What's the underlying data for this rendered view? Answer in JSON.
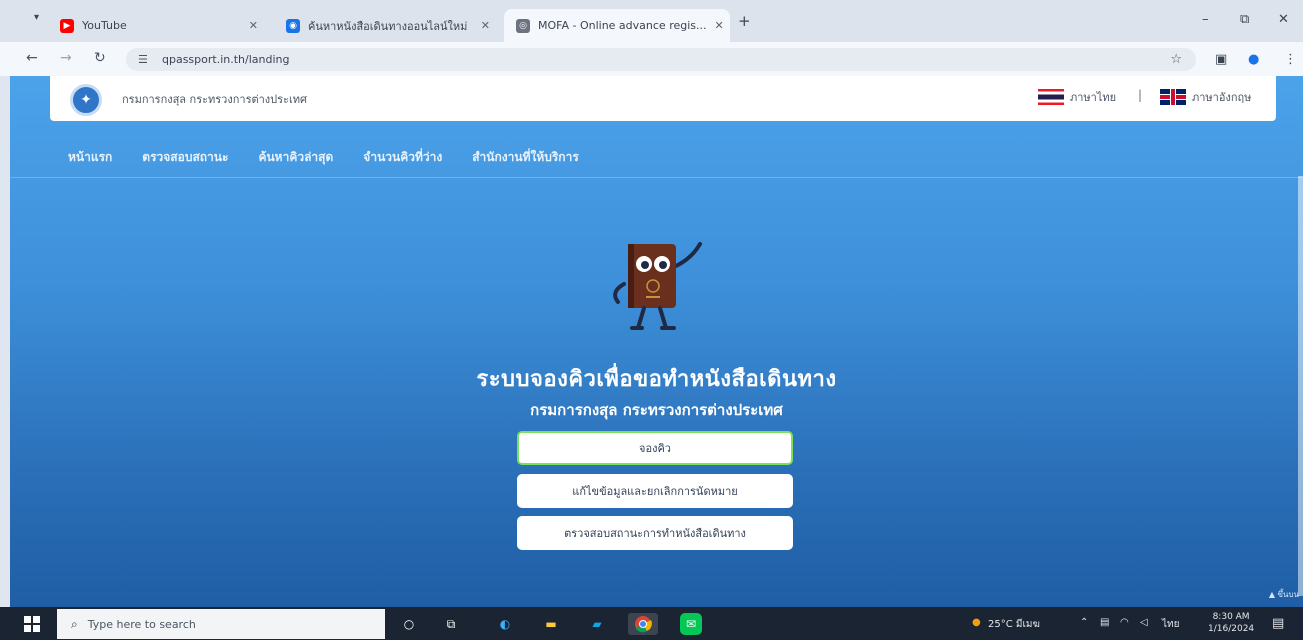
{
  "browser": {
    "tabs": [
      {
        "title": "YouTube",
        "active": false,
        "favicon_color": "#ff0000"
      },
      {
        "title": "ค้นหาหนังสือเดินทางออนไลน์ใหม่",
        "active": false,
        "favicon_color": "#1a73e8"
      },
      {
        "title": "MOFA - Online advance regis...",
        "active": true,
        "favicon_color": "#6b7280"
      }
    ],
    "new_tab_label": "+",
    "url": "qpassport.in.th/landing",
    "window_controls": [
      "–",
      "⧉",
      "✕"
    ]
  },
  "site": {
    "org_name": "กรมการกงสุล กระทรวงการต่างประเทศ",
    "lang_th": "ภาษาไทย",
    "lang_en": "ภาษาอังกฤษ",
    "lang_separator": "|",
    "nav": [
      "หน้าแรก",
      "ตรวจสอบสถานะ",
      "ค้นหาคิวล่าสุด",
      "จำนวนคิวที่ว่าง",
      "สำนักงานที่ให้บริการ"
    ],
    "hero_title": "ระบบจองคิวเพื่อขอทำหนังสือเดินทาง",
    "hero_subtitle": "กรมการกงสุล กระทรวงการต่างประเทศ",
    "buttons": {
      "book": "จองคิว",
      "edit": "แก้ไขข้อมูลและยกเลิกการนัดหมาย",
      "status": "ตรวจสอบสถานะการทำหนังสือเดินทาง"
    },
    "corner_label": "▲ ขึ้นบน"
  },
  "taskbar": {
    "search_placeholder": "Type here to search",
    "weather": "25°C มีเมฆ",
    "input_lang": "ไทย",
    "time": "8:30 AM",
    "date": "1/16/2024"
  },
  "colors": {
    "page_top": "#4ca3ea",
    "page_bottom": "#1f5ea5",
    "primary_button_border": "#7be05c"
  }
}
